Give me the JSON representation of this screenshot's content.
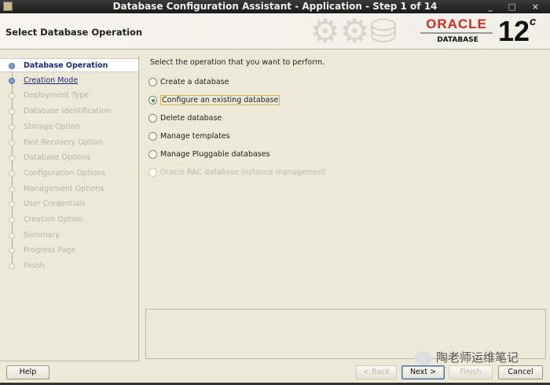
{
  "window": {
    "title": "Database Configuration Assistant - Application - Step 1 of 14",
    "controls": "_ □ ×"
  },
  "header": {
    "page_title": "Select Database Operation",
    "logo_brand": "ORACLE",
    "logo_sub": "DATABASE",
    "version": "12",
    "version_suffix": "c"
  },
  "steps": [
    {
      "label": "Database Operation",
      "state": "active"
    },
    {
      "label": "Creation Mode",
      "state": "link"
    },
    {
      "label": "Deployment Type",
      "state": "disabled"
    },
    {
      "label": "Database Identification",
      "state": "disabled"
    },
    {
      "label": "Storage Option",
      "state": "disabled"
    },
    {
      "label": "Fast Recovery Option",
      "state": "disabled"
    },
    {
      "label": "Database Options",
      "state": "disabled"
    },
    {
      "label": "Configuration Options",
      "state": "disabled"
    },
    {
      "label": "Management Options",
      "state": "disabled"
    },
    {
      "label": "User Credentials",
      "state": "disabled"
    },
    {
      "label": "Creation Option",
      "state": "disabled"
    },
    {
      "label": "Summary",
      "state": "disabled"
    },
    {
      "label": "Progress Page",
      "state": "disabled"
    },
    {
      "label": "Finish",
      "state": "disabled"
    }
  ],
  "main": {
    "prompt": "Select the operation that you want to perform.",
    "options": [
      {
        "label": "Create a database",
        "selected": false,
        "enabled": true
      },
      {
        "label": "Configure an existing database",
        "selected": true,
        "enabled": true
      },
      {
        "label": "Delete database",
        "selected": false,
        "enabled": true
      },
      {
        "label": "Manage templates",
        "selected": false,
        "enabled": true
      },
      {
        "label": "Manage Pluggable databases",
        "selected": false,
        "enabled": true
      },
      {
        "label": "Oracle RAC database Instance management",
        "selected": false,
        "enabled": false
      }
    ]
  },
  "buttons": {
    "help": "Help",
    "back": "< Back",
    "next": "Next >",
    "finish": "Finish",
    "cancel": "Cancel"
  },
  "watermark": "陶老师运维笔记"
}
